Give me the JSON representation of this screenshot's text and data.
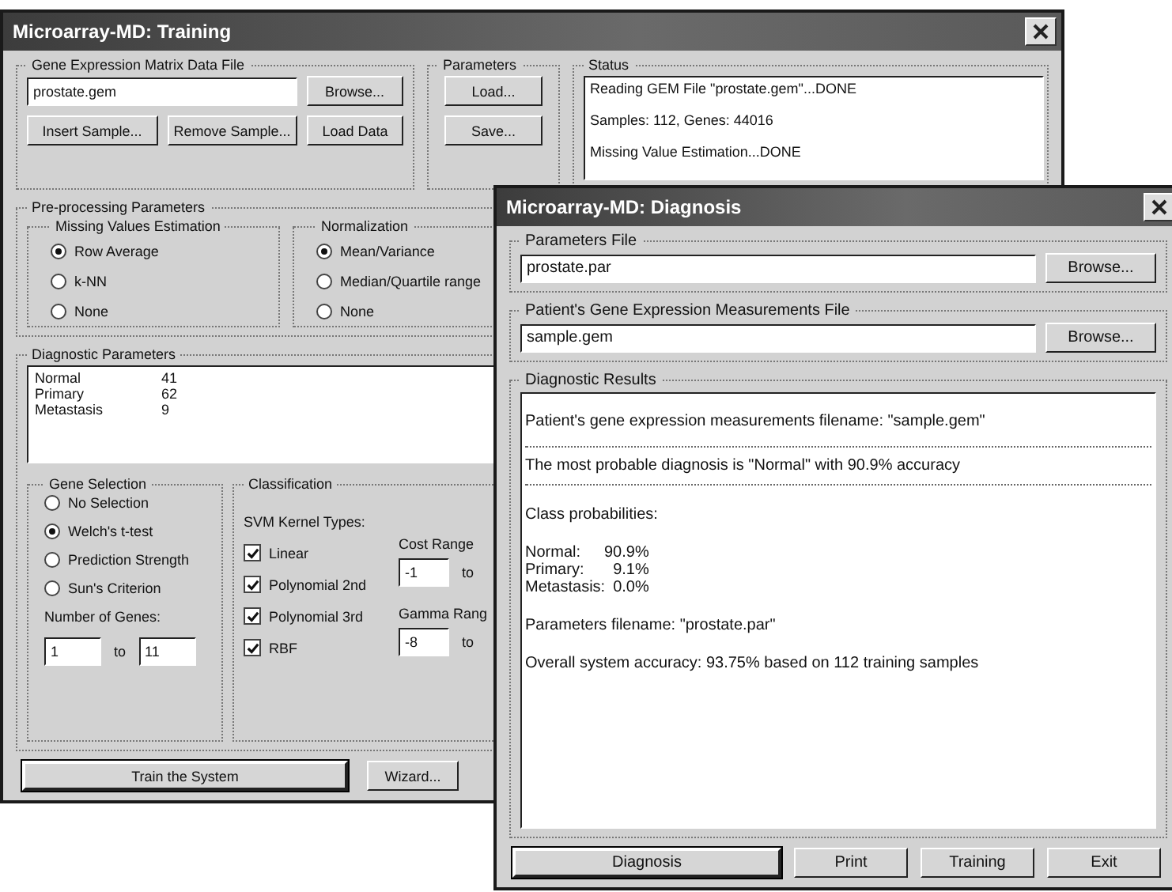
{
  "training_window": {
    "title": "Microarray-MD: Training",
    "data_file": {
      "label": "Gene Expression Matrix Data File",
      "value": "prostate.gem",
      "browse": "Browse...",
      "buttons": [
        "Insert Sample...",
        "Remove Sample...",
        "Load Data"
      ]
    },
    "parameters": {
      "label": "Parameters",
      "buttons": [
        "Load...",
        "Save..."
      ]
    },
    "status": {
      "label": "Status",
      "lines": [
        "Reading GEM File \"prostate.gem\"...DONE",
        "Samples: 112, Genes: 44016",
        "Missing Value Estimation...DONE"
      ]
    },
    "preprocessing": {
      "label": "Pre-processing Parameters",
      "missing_values": {
        "label": "Missing Values Estimation",
        "options": [
          {
            "label": "Row Average",
            "selected": true
          },
          {
            "label": "k-NN",
            "selected": false
          },
          {
            "label": "None",
            "selected": false
          }
        ]
      },
      "normalization": {
        "label": "Normalization",
        "options": [
          {
            "label": "Mean/Variance",
            "selected": true
          },
          {
            "label": "Median/Quartile range",
            "selected": false
          },
          {
            "label": "None",
            "selected": false
          }
        ]
      }
    },
    "diagnostic_parameters": {
      "label": "Diagnostic Parameters",
      "rows": [
        {
          "class": "Normal",
          "count": "41"
        },
        {
          "class": "Primary",
          "count": "62"
        },
        {
          "class": "Metastasis",
          "count": "9"
        }
      ]
    },
    "gene_selection": {
      "label": "Gene Selection",
      "options": [
        {
          "label": "No Selection",
          "selected": false
        },
        {
          "label": "Welch's t-test",
          "selected": true
        },
        {
          "label": "Prediction Strength",
          "selected": false
        },
        {
          "label": "Sun's Criterion",
          "selected": false
        }
      ],
      "number_label": "Number of Genes:",
      "from": "1",
      "to_label": "to",
      "to": "11"
    },
    "classification": {
      "label": "Classification",
      "kernel_label": "SVM Kernel Types:",
      "kernels": [
        {
          "label": "Linear",
          "checked": true
        },
        {
          "label": "Polynomial 2nd",
          "checked": true
        },
        {
          "label": "Polynomial 3rd",
          "checked": true
        },
        {
          "label": "RBF",
          "checked": true
        }
      ],
      "cost_range": {
        "label": "Cost Range",
        "from": "-1",
        "to_label": "to"
      },
      "gamma_range": {
        "label": "Gamma Rang",
        "from": "-8",
        "to_label": "to"
      }
    },
    "buttons": [
      {
        "label": "Train the System",
        "default": true
      },
      {
        "label": "Wizard...",
        "default": false
      }
    ]
  },
  "diagnosis_window": {
    "title": "Microarray-MD: Diagnosis",
    "parameters_file": {
      "label": "Parameters File",
      "value": "prostate.par",
      "browse": "Browse..."
    },
    "patient_file": {
      "label": "Patient's Gene Expression Measurements File",
      "value": "sample.gem",
      "browse": "Browse..."
    },
    "results": {
      "label": "Diagnostic Results",
      "lines": [
        {
          "kind": "text",
          "text": "Patient's gene expression measurements filename: \"sample.gem\""
        },
        {
          "kind": "ruled",
          "text": "The most probable diagnosis is \"Normal\" with 90.9% accuracy"
        },
        {
          "kind": "text",
          "text": "Class probabilities:"
        },
        {
          "kind": "table",
          "rows": [
            {
              "class": "Normal:",
              "value": "90.9%"
            },
            {
              "class": "Primary:",
              "value": "9.1%"
            },
            {
              "class": "Metastasis:",
              "value": "0.0%"
            }
          ]
        },
        {
          "kind": "text",
          "text": "Parameters filename: \"prostate.par\""
        },
        {
          "kind": "text",
          "text": "Overall system accuracy: 93.75% based on 112 training samples"
        }
      ]
    },
    "buttons": [
      {
        "label": "Diagnosis",
        "default": true
      },
      {
        "label": "Print",
        "default": false
      },
      {
        "label": "Training",
        "default": false
      },
      {
        "label": "Exit",
        "default": false
      }
    ]
  }
}
